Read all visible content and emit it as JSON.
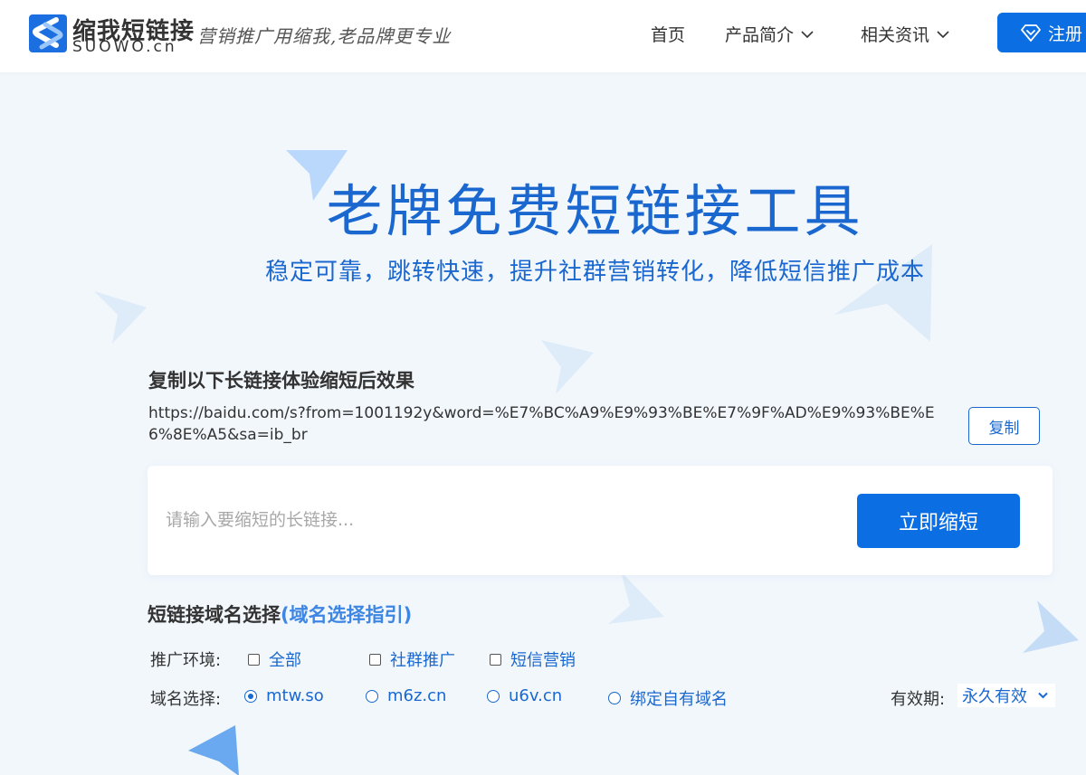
{
  "header": {
    "logo_cn": "缩我短链接",
    "logo_en": "SUOWO.cn",
    "slogan_dot": "·",
    "slogan": "营销推广用缩我,老品牌更专业",
    "nav": [
      {
        "label": "首页"
      },
      {
        "label": "产品简介"
      },
      {
        "label": "相关资讯"
      }
    ],
    "register_label": "注册"
  },
  "hero": {
    "title": "老牌免费短链接工具",
    "subtitle": "稳定可靠，跳转快速，提升社群营销转化，降低短信推广成本"
  },
  "sample": {
    "title": "复制以下长链接体验缩短后效果",
    "url": "https://baidu.com/s?from=1001192y&word=%E7%BC%A9%E9%93%BE%E7%9F%AD%E9%93%BE%E6%8E%A5&sa=ib_br",
    "copy_label": "复制"
  },
  "shortener": {
    "placeholder": "请输入要缩短的长链接...",
    "button_label": "立即缩短"
  },
  "domain": {
    "title": "短链接域名选择",
    "guide": "(域名选择指引)",
    "env_label": "推广环境:",
    "env_options": [
      {
        "label": "全部",
        "checked": false
      },
      {
        "label": "社群推广",
        "checked": false
      },
      {
        "label": "短信营销",
        "checked": false
      }
    ],
    "domain_label": "域名选择:",
    "domain_options": [
      {
        "label": "mtw.so",
        "selected": true
      },
      {
        "label": "m6z.cn",
        "selected": false
      },
      {
        "label": "u6v.cn",
        "selected": false
      },
      {
        "label": "绑定自有域名",
        "selected": false
      }
    ],
    "validity_label": "有效期:",
    "validity_value": "永久有效"
  },
  "colors": {
    "primary": "#0b6ee3",
    "accent_text": "#1a68cf",
    "background": "#f2f7fc"
  }
}
